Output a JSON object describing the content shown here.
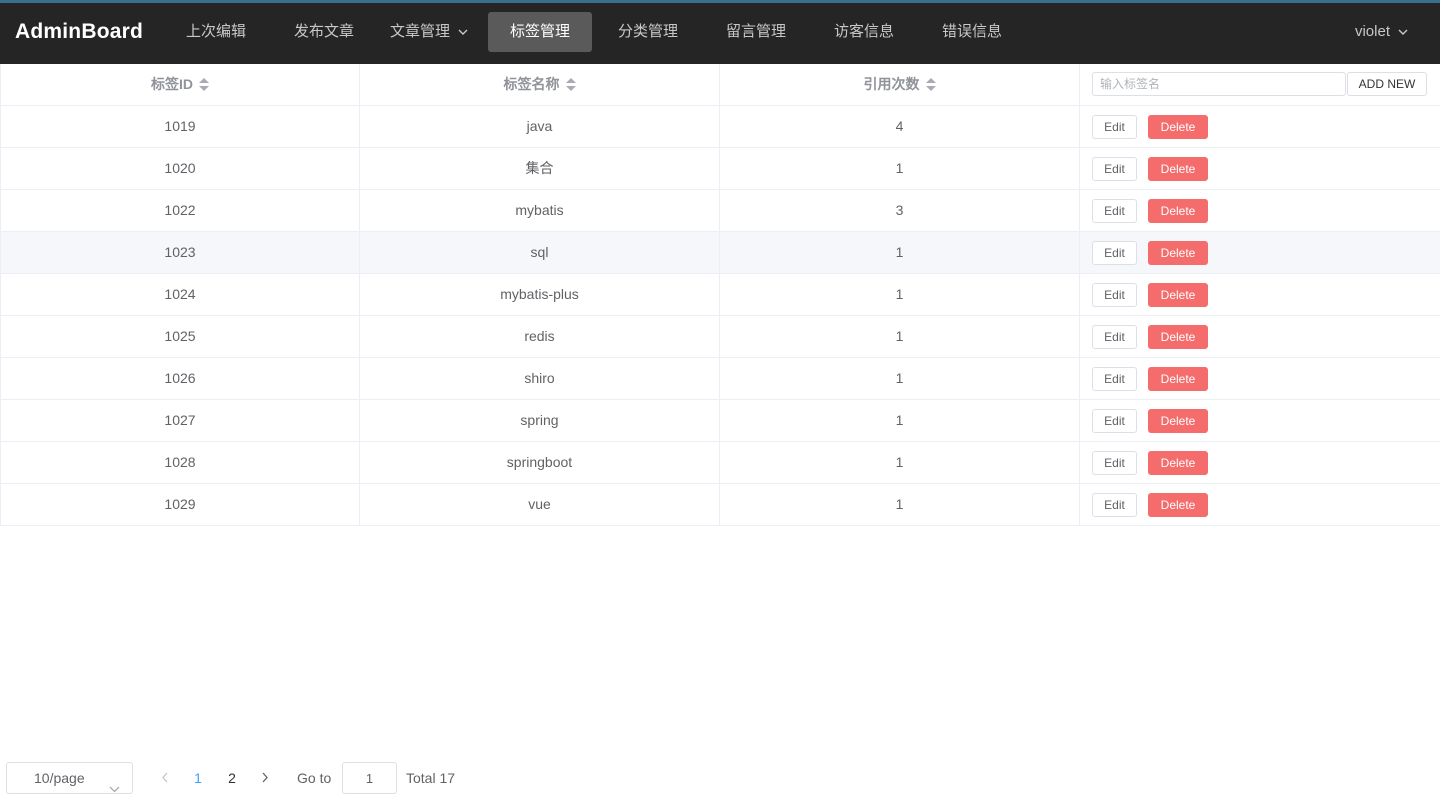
{
  "app": {
    "brand": "AdminBoard",
    "user": "violet"
  },
  "nav": [
    {
      "label": "上次编辑",
      "active": false,
      "dropdown": false
    },
    {
      "label": "发布文章",
      "active": false,
      "dropdown": false
    },
    {
      "label": "文章管理",
      "active": false,
      "dropdown": true
    },
    {
      "label": "标签管理",
      "active": true,
      "dropdown": false
    },
    {
      "label": "分类管理",
      "active": false,
      "dropdown": false
    },
    {
      "label": "留言管理",
      "active": false,
      "dropdown": false
    },
    {
      "label": "访客信息",
      "active": false,
      "dropdown": false
    },
    {
      "label": "错误信息",
      "active": false,
      "dropdown": false
    }
  ],
  "table": {
    "columns": [
      "标签ID",
      "标签名称",
      "引用次数"
    ],
    "search_placeholder": "输入标签名",
    "add_label": "ADD NEW",
    "edit_label": "Edit",
    "delete_label": "Delete",
    "rows": [
      {
        "id": "1019",
        "name": "java",
        "count": "4"
      },
      {
        "id": "1020",
        "name": "集合",
        "count": "1"
      },
      {
        "id": "1022",
        "name": "mybatis",
        "count": "3"
      },
      {
        "id": "1023",
        "name": "sql",
        "count": "1",
        "hovered": true
      },
      {
        "id": "1024",
        "name": "mybatis-plus",
        "count": "1"
      },
      {
        "id": "1025",
        "name": "redis",
        "count": "1"
      },
      {
        "id": "1026",
        "name": "shiro",
        "count": "1"
      },
      {
        "id": "1027",
        "name": "spring",
        "count": "1"
      },
      {
        "id": "1028",
        "name": "springboot",
        "count": "1"
      },
      {
        "id": "1029",
        "name": "vue",
        "count": "1"
      }
    ]
  },
  "pagination": {
    "page_size": "10/page",
    "pages": [
      "1",
      "2"
    ],
    "current": "1",
    "goto_label": "Go to",
    "goto_value": "1",
    "total": "Total 17"
  },
  "colors": {
    "navbar": "#252525",
    "active_nav": "#5a5a5a",
    "danger": "#f56c6c",
    "primary": "#409eff"
  }
}
